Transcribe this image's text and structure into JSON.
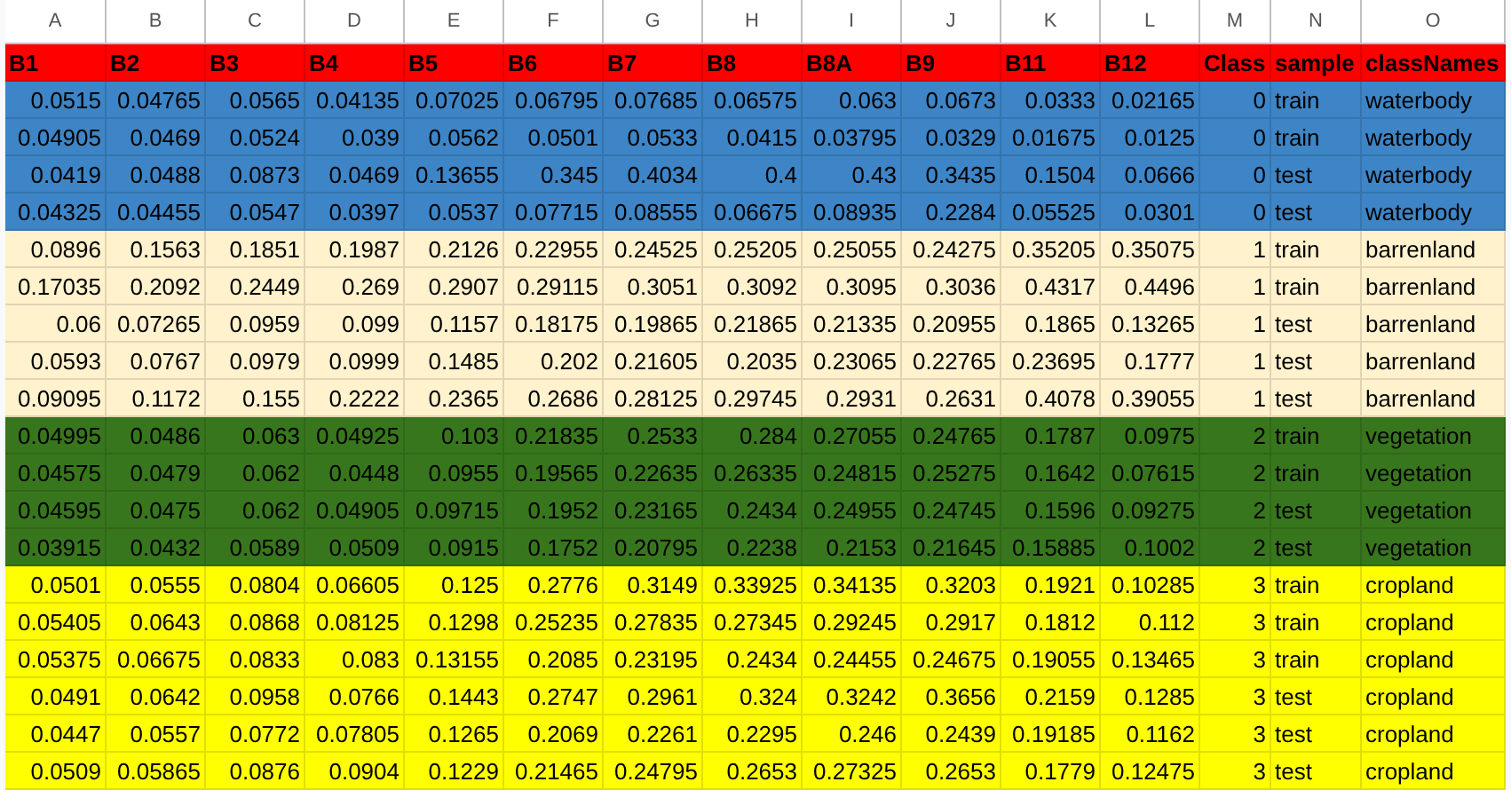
{
  "column_letters": [
    "A",
    "B",
    "C",
    "D",
    "E",
    "F",
    "G",
    "H",
    "I",
    "J",
    "K",
    "L",
    "M",
    "N",
    "O"
  ],
  "header": {
    "color": "#ff0000",
    "cells": [
      "B1",
      "B2",
      "B3",
      "B4",
      "B5",
      "B6",
      "B7",
      "B8",
      "B8A",
      "B9",
      "B11",
      "B12",
      "Class",
      "sample",
      "classNames"
    ]
  },
  "rows": [
    {
      "color": "#3d85c6",
      "cells": [
        "0.0515",
        "0.04765",
        "0.0565",
        "0.04135",
        "0.07025",
        "0.06795",
        "0.07685",
        "0.06575",
        "0.063",
        "0.0673",
        "0.0333",
        "0.02165",
        "0",
        "train",
        "waterbody"
      ]
    },
    {
      "color": "#3d85c6",
      "cells": [
        "0.04905",
        "0.0469",
        "0.0524",
        "0.039",
        "0.0562",
        "0.0501",
        "0.0533",
        "0.0415",
        "0.03795",
        "0.0329",
        "0.01675",
        "0.0125",
        "0",
        "train",
        "waterbody"
      ]
    },
    {
      "color": "#3d85c6",
      "cells": [
        "0.0419",
        "0.0488",
        "0.0873",
        "0.0469",
        "0.13655",
        "0.345",
        "0.4034",
        "0.4",
        "0.43",
        "0.3435",
        "0.1504",
        "0.0666",
        "0",
        "test",
        "waterbody"
      ]
    },
    {
      "color": "#3d85c6",
      "cells": [
        "0.04325",
        "0.04455",
        "0.0547",
        "0.0397",
        "0.0537",
        "0.07715",
        "0.08555",
        "0.06675",
        "0.08935",
        "0.2284",
        "0.05525",
        "0.0301",
        "0",
        "test",
        "waterbody"
      ]
    },
    {
      "color": "#fff2cc",
      "cells": [
        "0.0896",
        "0.1563",
        "0.1851",
        "0.1987",
        "0.2126",
        "0.22955",
        "0.24525",
        "0.25205",
        "0.25055",
        "0.24275",
        "0.35205",
        "0.35075",
        "1",
        "train",
        "barrenland"
      ]
    },
    {
      "color": "#fff2cc",
      "cells": [
        "0.17035",
        "0.2092",
        "0.2449",
        "0.269",
        "0.2907",
        "0.29115",
        "0.3051",
        "0.3092",
        "0.3095",
        "0.3036",
        "0.4317",
        "0.4496",
        "1",
        "train",
        "barrenland"
      ]
    },
    {
      "color": "#fff2cc",
      "cells": [
        "0.06",
        "0.07265",
        "0.0959",
        "0.099",
        "0.1157",
        "0.18175",
        "0.19865",
        "0.21865",
        "0.21335",
        "0.20955",
        "0.1865",
        "0.13265",
        "1",
        "test",
        "barrenland"
      ]
    },
    {
      "color": "#fff2cc",
      "cells": [
        "0.0593",
        "0.0767",
        "0.0979",
        "0.0999",
        "0.1485",
        "0.202",
        "0.21605",
        "0.2035",
        "0.23065",
        "0.22765",
        "0.23695",
        "0.1777",
        "1",
        "test",
        "barrenland"
      ]
    },
    {
      "color": "#fff2cc",
      "cells": [
        "0.09095",
        "0.1172",
        "0.155",
        "0.2222",
        "0.2365",
        "0.2686",
        "0.28125",
        "0.29745",
        "0.2931",
        "0.2631",
        "0.4078",
        "0.39055",
        "1",
        "test",
        "barrenland"
      ]
    },
    {
      "color": "#38761d",
      "cells": [
        "0.04995",
        "0.0486",
        "0.063",
        "0.04925",
        "0.103",
        "0.21835",
        "0.2533",
        "0.284",
        "0.27055",
        "0.24765",
        "0.1787",
        "0.0975",
        "2",
        "train",
        "vegetation"
      ]
    },
    {
      "color": "#38761d",
      "cells": [
        "0.04575",
        "0.0479",
        "0.062",
        "0.0448",
        "0.0955",
        "0.19565",
        "0.22635",
        "0.26335",
        "0.24815",
        "0.25275",
        "0.1642",
        "0.07615",
        "2",
        "train",
        "vegetation"
      ]
    },
    {
      "color": "#38761d",
      "cells": [
        "0.04595",
        "0.0475",
        "0.062",
        "0.04905",
        "0.09715",
        "0.1952",
        "0.23165",
        "0.2434",
        "0.24955",
        "0.24745",
        "0.1596",
        "0.09275",
        "2",
        "test",
        "vegetation"
      ]
    },
    {
      "color": "#38761d",
      "cells": [
        "0.03915",
        "0.0432",
        "0.0589",
        "0.0509",
        "0.0915",
        "0.1752",
        "0.20795",
        "0.2238",
        "0.2153",
        "0.21645",
        "0.15885",
        "0.1002",
        "2",
        "test",
        "vegetation"
      ]
    },
    {
      "color": "#ffff00",
      "cells": [
        "0.0501",
        "0.0555",
        "0.0804",
        "0.06605",
        "0.125",
        "0.2776",
        "0.3149",
        "0.33925",
        "0.34135",
        "0.3203",
        "0.1921",
        "0.10285",
        "3",
        "train",
        "cropland"
      ]
    },
    {
      "color": "#ffff00",
      "cells": [
        "0.05405",
        "0.0643",
        "0.0868",
        "0.08125",
        "0.1298",
        "0.25235",
        "0.27835",
        "0.27345",
        "0.29245",
        "0.2917",
        "0.1812",
        "0.112",
        "3",
        "train",
        "cropland"
      ]
    },
    {
      "color": "#ffff00",
      "cells": [
        "0.05375",
        "0.06675",
        "0.0833",
        "0.083",
        "0.13155",
        "0.2085",
        "0.23195",
        "0.2434",
        "0.24455",
        "0.24675",
        "0.19055",
        "0.13465",
        "3",
        "train",
        "cropland"
      ]
    },
    {
      "color": "#ffff00",
      "cells": [
        "0.0491",
        "0.0642",
        "0.0958",
        "0.0766",
        "0.1443",
        "0.2747",
        "0.2961",
        "0.324",
        "0.3242",
        "0.3656",
        "0.2159",
        "0.1285",
        "3",
        "test",
        "cropland"
      ]
    },
    {
      "color": "#ffff00",
      "cells": [
        "0.0447",
        "0.0557",
        "0.0772",
        "0.07805",
        "0.1265",
        "0.2069",
        "0.2261",
        "0.2295",
        "0.246",
        "0.2439",
        "0.19185",
        "0.1162",
        "3",
        "test",
        "cropland"
      ]
    },
    {
      "color": "#ffff00",
      "cells": [
        "0.0509",
        "0.05865",
        "0.0876",
        "0.0904",
        "0.1229",
        "0.21465",
        "0.24795",
        "0.2653",
        "0.27325",
        "0.2653",
        "0.1779",
        "0.12475",
        "3",
        "test",
        "cropland"
      ]
    }
  ]
}
